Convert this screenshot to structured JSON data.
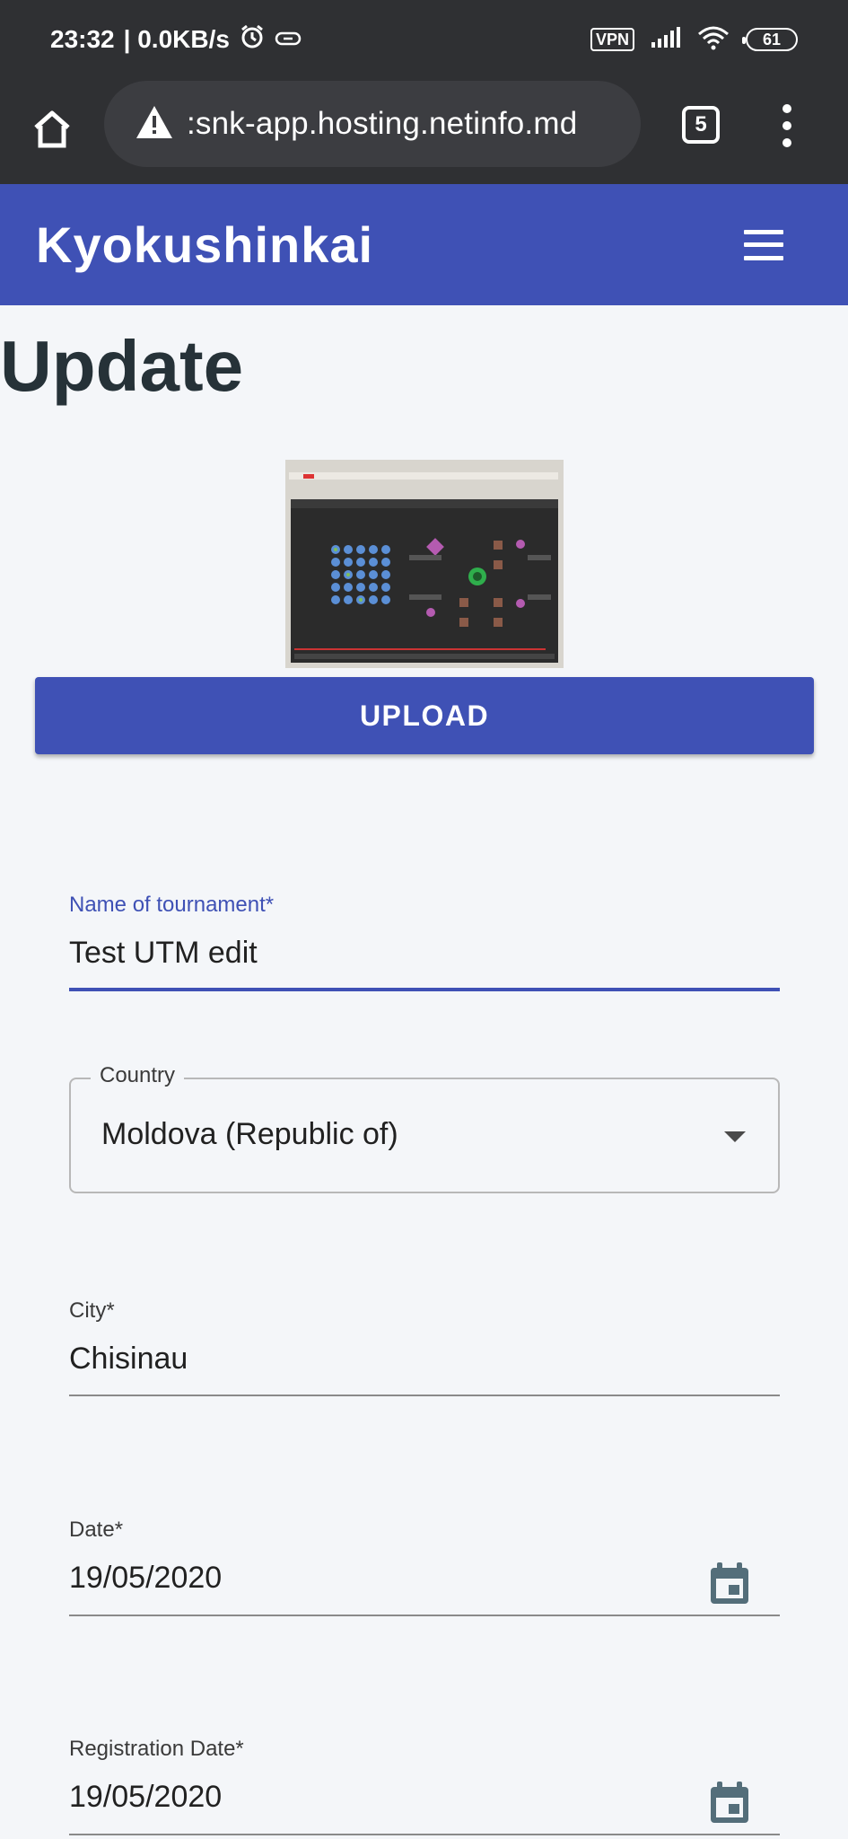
{
  "status_bar": {
    "time": "23:32",
    "network_speed": "| 0.0KB/s",
    "vpn": "VPN",
    "battery": "61"
  },
  "browser": {
    "url": ":snk-app.hosting.netinfo.md",
    "tab_count": "5"
  },
  "app_bar": {
    "title": "Kyokushinkai"
  },
  "page": {
    "title": "Update",
    "upload_label": "UPLOAD"
  },
  "form": {
    "tournament_name": {
      "label": "Name of tournament*",
      "value": "Test UTM edit"
    },
    "country": {
      "label": "Country",
      "value": "Moldova (Republic of)"
    },
    "city": {
      "label": "City*",
      "value": "Chisinau"
    },
    "date": {
      "label": "Date*",
      "value": "19/05/2020"
    },
    "registration_date": {
      "label": "Registration Date*",
      "value": "19/05/2020"
    }
  },
  "colors": {
    "primary": "#3f51b5",
    "status_bar": "#2f3033",
    "background": "#f4f6f9"
  }
}
